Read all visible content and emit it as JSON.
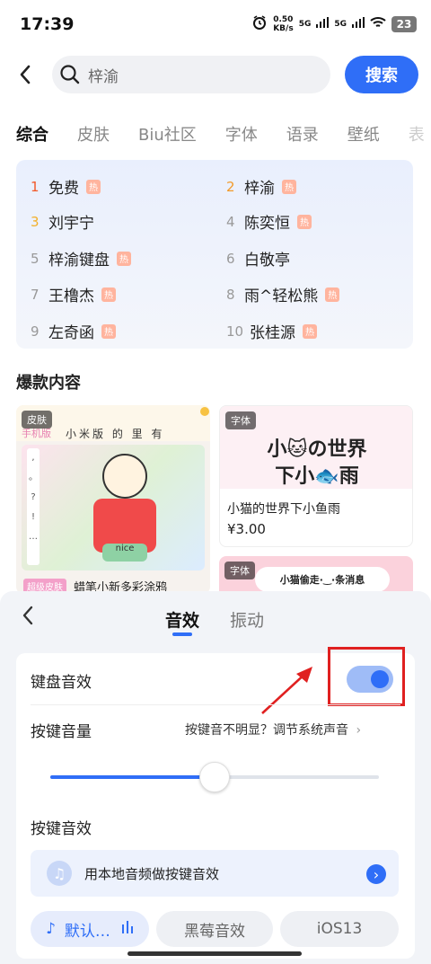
{
  "status": {
    "time": "17:39",
    "net_speed": "0.50",
    "net_unit": "KB/s",
    "sig1": "5G",
    "sig2": "5G",
    "battery": "23"
  },
  "search": {
    "query": "梓渝",
    "button": "搜索"
  },
  "tabs": [
    "综合",
    "皮肤",
    "Biu社区",
    "字体",
    "语录",
    "壁纸",
    "表"
  ],
  "hot_list": [
    {
      "rank": "1",
      "name": "免费",
      "hot": true
    },
    {
      "rank": "2",
      "name": "梓渝",
      "hot": true
    },
    {
      "rank": "3",
      "name": "刘宇宁",
      "hot": false
    },
    {
      "rank": "4",
      "name": "陈奕恒",
      "hot": true
    },
    {
      "rank": "5",
      "name": "梓渝键盘",
      "hot": true
    },
    {
      "rank": "6",
      "name": "白敬亭",
      "hot": false
    },
    {
      "rank": "7",
      "name": "王橹杰",
      "hot": true
    },
    {
      "rank": "8",
      "name": "雨^轻松熊",
      "hot": true
    },
    {
      "rank": "9",
      "name": "左奇函",
      "hot": true
    },
    {
      "rank": "10",
      "name": "张桂源",
      "hot": true
    }
  ],
  "hot_badge": "热",
  "section_title": "爆款内容",
  "cards": {
    "c1": {
      "tag": "皮肤",
      "sub_tag": "手机版",
      "title_strip": "小米版 的 里 有",
      "badge": "超级皮肤",
      "name": "蜡笔小新多彩涂鸦"
    },
    "c2": {
      "tag": "字体",
      "art_line1": "小🐱の世界",
      "art_line2": "下小🐟雨",
      "name": "小猫的世界下小鱼雨",
      "price": "¥3.00"
    },
    "c3": {
      "tag": "字体",
      "banner": "小猫偷走·‿·条消息"
    }
  },
  "sheet": {
    "tab_sound": "音效",
    "tab_vibrate": "振动",
    "key_sound": "键盘音效",
    "volume": "按键音量",
    "volume_hint": "按键音不明显？调节系统声音",
    "volume_level": 0.5,
    "key_effect": "按键音效",
    "local_audio": "用本地音频做按键音效",
    "chips": [
      "默认…",
      "黑莓音效",
      "iOS13"
    ]
  },
  "colors": {
    "accent": "#2f6ef7",
    "highlight": "#e02020"
  }
}
